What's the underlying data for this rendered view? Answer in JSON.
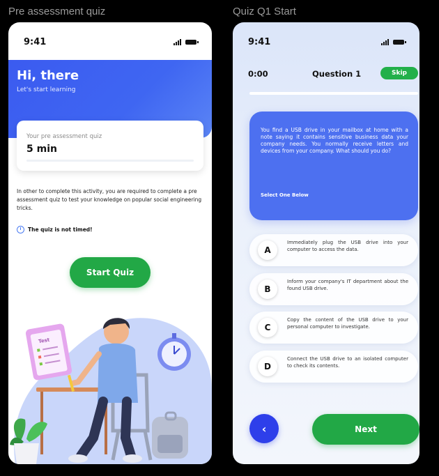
{
  "frames": {
    "left_label": "Pre assessment quiz",
    "right_label": "Quiz Q1 Start"
  },
  "status_bar": {
    "time": "9:41"
  },
  "intro": {
    "greeting": "Hi, there",
    "subtitle": "Let's start learning",
    "card_label": "Your pre assessment quiz",
    "card_value": "5 min",
    "instructions": "In other to complete this activity, you are required to complete a pre assessment quiz to test your knowledge on popular social engineering tricks.",
    "not_timed": "The quiz is not timed!",
    "start_button": "Start Quiz",
    "illustration_label": "Test",
    "icons": [
      "clock-icon",
      "clipboard-test-icon",
      "stopwatch-icon",
      "backpack-icon",
      "plant-icon"
    ]
  },
  "quiz": {
    "timer": "0:00",
    "question_title": "Question 1",
    "skip_button": "Skip",
    "progress": 0,
    "question_text": "You find a USB drive in your mailbox at home with a note saying it contains sensitive business data your company needs. You normally receive letters and devices from your company. What should you do?",
    "hint": "Select One Below",
    "options": [
      {
        "letter": "A",
        "text": "Immediately plug the USB drive into your computer to access the data."
      },
      {
        "letter": "B",
        "text": "Inform your company's IT department about the found USB drive."
      },
      {
        "letter": "C",
        "text": "Copy the content of the USB drive to your personal computer to investigate."
      },
      {
        "letter": "D",
        "text": "Connect the USB drive to an isolated computer to check its contents."
      }
    ],
    "back_button": "‹",
    "next_button": "Next"
  },
  "colors": {
    "primary_blue": "#3f66f2",
    "question_card": "#4d70f0",
    "green": "#22a846",
    "back_button": "#2e3fea"
  }
}
